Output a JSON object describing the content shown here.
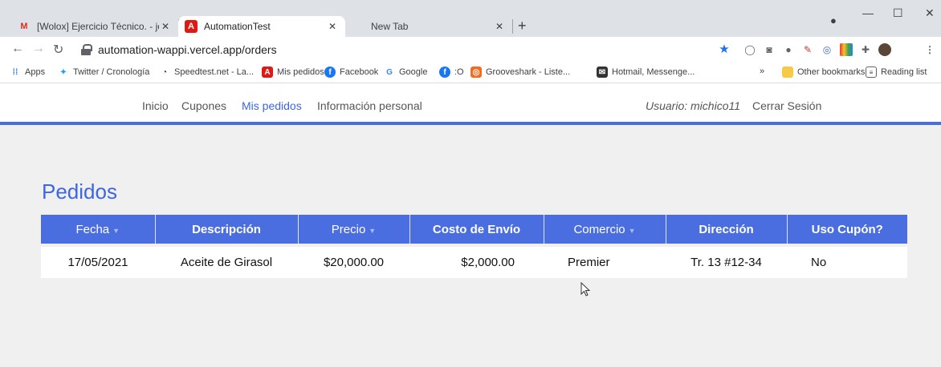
{
  "browser": {
    "tabs": [
      {
        "title": "[Wolox] Ejercicio Técnico. - johnd",
        "icon": "gmail-icon",
        "active": false
      },
      {
        "title": "AutomationTest",
        "icon": "angular-icon",
        "active": true
      },
      {
        "title": "New Tab",
        "icon": "",
        "active": false
      }
    ],
    "new_tab_symbol": "+",
    "url": "automation-wappi.vercel.app/orders",
    "bookmarks": [
      {
        "label": "Apps",
        "icon": "apps-grid-icon"
      },
      {
        "label": "Twitter / Cronología",
        "icon": "twitter-icon"
      },
      {
        "label": "Speedtest.net - La...",
        "icon": "speedtest-icon"
      },
      {
        "label": "Mis pedidos",
        "icon": "angular-icon"
      },
      {
        "label": "Facebook",
        "icon": "facebook-icon"
      },
      {
        "label": "Google",
        "icon": "google-icon"
      },
      {
        "label": ":O",
        "icon": "facebook-icon"
      },
      {
        "label": "Grooveshark - Liste...",
        "icon": "grooveshark-icon"
      },
      {
        "label": "Hotmail, Messenge...",
        "icon": "messenger-icon"
      }
    ],
    "overflow_symbol": "»",
    "other_bookmarks": "Other bookmarks",
    "reading_list": "Reading list"
  },
  "nav": {
    "items": [
      {
        "label": "Inicio",
        "active": false
      },
      {
        "label": "Cupones",
        "active": false
      },
      {
        "label": "Mis pedidos",
        "active": true
      },
      {
        "label": "Información personal",
        "active": false
      }
    ],
    "user_label": "Usuario: michico11",
    "logout": "Cerrar Sesión"
  },
  "page": {
    "title": "Pedidos"
  },
  "table": {
    "columns": [
      {
        "label": "Fecha",
        "sortable": true
      },
      {
        "label": "Descripción",
        "sortable": false
      },
      {
        "label": "Precio",
        "sortable": true
      },
      {
        "label": "Costo de Envío",
        "sortable": false
      },
      {
        "label": "Comercio",
        "sortable": true
      },
      {
        "label": "Dirección",
        "sortable": false
      },
      {
        "label": "Uso Cupón?",
        "sortable": false
      }
    ],
    "rows": [
      [
        "17/05/2021",
        "Aceite de Girasol",
        "$20,000.00",
        "$2,000.00",
        "Premier",
        "Tr. 13 #12-34",
        "No"
      ]
    ]
  },
  "colors": {
    "accent": "#3d66e0",
    "header_bg": "#4a6ee0",
    "page_bg": "#f0f0f0"
  }
}
